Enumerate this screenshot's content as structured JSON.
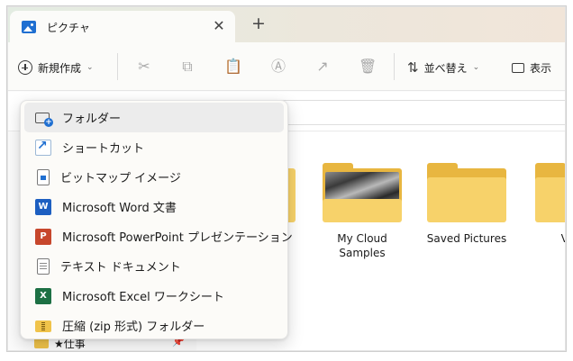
{
  "tab": {
    "title": "ピクチャ",
    "close": "✕",
    "new_tab": "+"
  },
  "toolbar": {
    "new_label": "新規作成",
    "new_chevron": "⌄",
    "sort_label": "並べ替え",
    "sort_chevron": "⌄",
    "view_label": "表示",
    "icons": [
      "cut-icon",
      "copy-icon",
      "paste-icon",
      "rename-icon",
      "share-icon",
      "delete-icon"
    ]
  },
  "menu": {
    "items": [
      {
        "label": "フォルダー",
        "icon": "new-folder-icon"
      },
      {
        "label": "ショートカット",
        "icon": "shortcut-icon"
      },
      {
        "label": "ビットマップ イメージ",
        "icon": "bitmap-icon"
      },
      {
        "label": "Microsoft Word 文書",
        "icon": "word-icon",
        "badge": "W"
      },
      {
        "label": "Microsoft PowerPoint プレゼンテーション",
        "icon": "powerpoint-icon",
        "badge": "P"
      },
      {
        "label": "テキスト ドキュメント",
        "icon": "text-document-icon"
      },
      {
        "label": "Microsoft Excel ワークシート",
        "icon": "excel-icon",
        "badge": "X"
      },
      {
        "label": "圧縮 (zip 形式) フォルダー",
        "icon": "zip-folder-icon"
      }
    ]
  },
  "folders": [
    {
      "label": "My Cloud Samples",
      "has_preview": true
    },
    {
      "label": "Saved Pictures",
      "has_preview": false
    },
    {
      "label": "Vi Co",
      "has_preview": false
    }
  ],
  "nav": {
    "item_label": "★仕事",
    "pin": "📌"
  },
  "colors": {
    "accent": "#1f6fd1",
    "folder": "#f7d26a",
    "menu_bg": "#fcfbf8"
  }
}
